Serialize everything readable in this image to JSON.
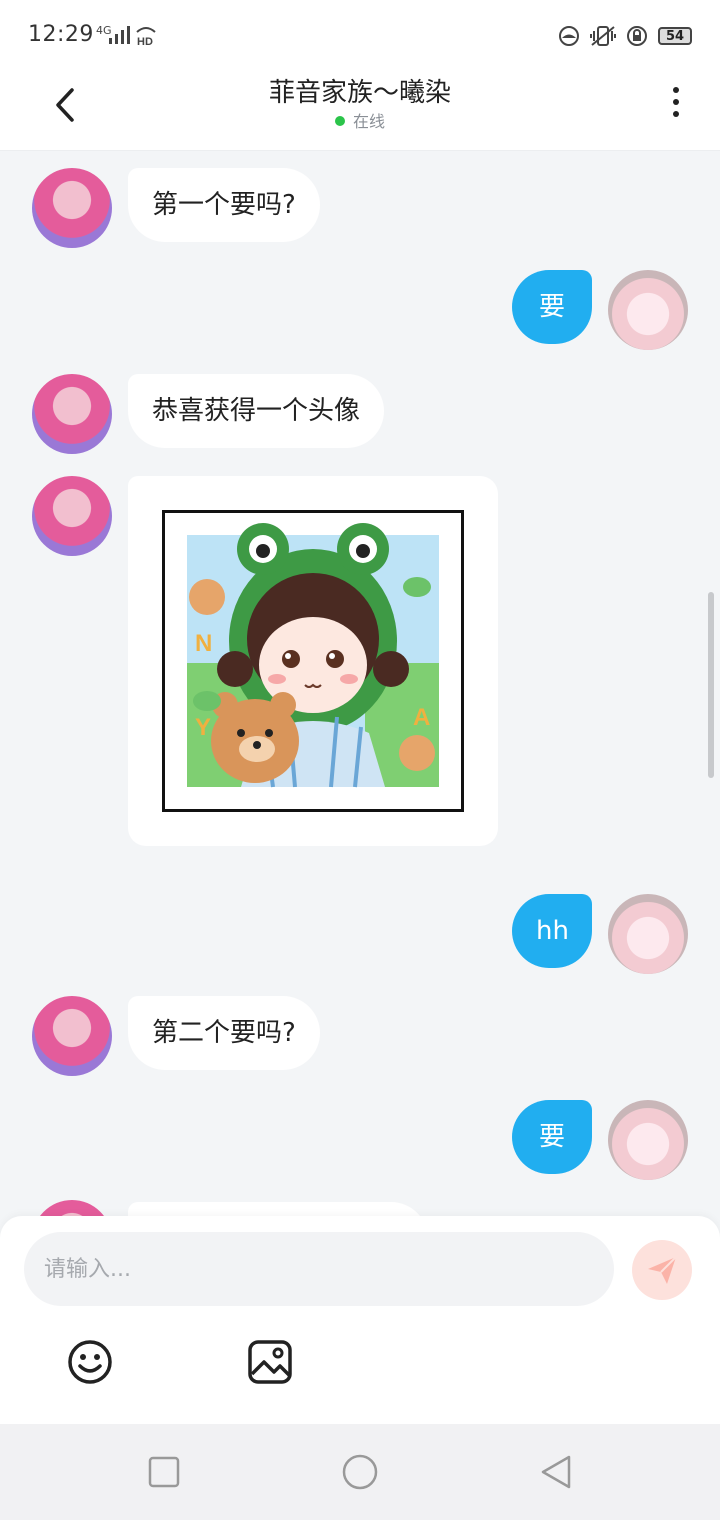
{
  "status": {
    "time": "12:29",
    "network": "4G",
    "hd": "HD",
    "battery": "54"
  },
  "header": {
    "title": "菲音家族～曦染",
    "status": "在线"
  },
  "messages": [
    {
      "side": "left",
      "text": "第一个要吗?"
    },
    {
      "side": "right",
      "text": "要"
    },
    {
      "side": "left",
      "text": "恭喜获得一个头像"
    },
    {
      "side": "left",
      "type": "image",
      "image_desc": "frog-hat girl avatar with teddy bear"
    },
    {
      "side": "right",
      "text": "hh"
    },
    {
      "side": "left",
      "text": "第二个要吗?"
    },
    {
      "side": "right",
      "text": "要"
    }
  ],
  "input": {
    "placeholder": "请输入..."
  },
  "colors": {
    "accent": "#21aef0",
    "online": "#2bc44a",
    "send_disabled": "#fde1dc",
    "chat_bg": "#f3f5f7"
  },
  "icons": [
    "back-icon",
    "more-icon",
    "emoji-icon",
    "image-icon",
    "send-icon",
    "recent-apps-icon",
    "home-icon",
    "back-nav-icon"
  ]
}
